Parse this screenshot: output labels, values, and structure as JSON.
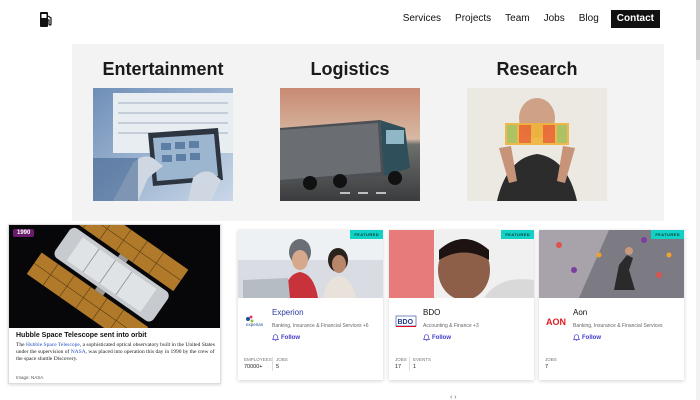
{
  "nav": {
    "logo_icon": "fuel-pump-icon",
    "links": [
      "Services",
      "Projects",
      "Team",
      "Jobs",
      "Blog"
    ],
    "cta": "Contact"
  },
  "categories": [
    {
      "title": "Entertainment",
      "image": "tablet-hands-photo"
    },
    {
      "title": "Logistics",
      "image": "truck-highway-photo"
    },
    {
      "title": "Research",
      "image": "person-color-filters-photo"
    }
  ],
  "hubble": {
    "badge": "1990",
    "title": "Hubble Space Telescope sent into orbit",
    "desc_prefix": "The ",
    "desc_link1": "Hubble Space Telescope",
    "desc_mid": ", a sophisticated optical observatory built in the United States under the supervision of ",
    "desc_link2": "NASA",
    "desc_suffix": ", was placed into operation this day in 1990 by the crew of the space shuttle Discovery.",
    "credit": "Image: NASA"
  },
  "companies": [
    {
      "badge": "FEATURED",
      "name": "Experion",
      "subtitle": "Banking, Insurance & Financial Services +6",
      "follow": "Follow",
      "stats": [
        {
          "label": "Employees",
          "value": "70000+"
        },
        {
          "label": "Jobs",
          "value": "5"
        }
      ],
      "logo_color": "#1d4f91"
    },
    {
      "badge": "FEATURED",
      "name": "BDO",
      "subtitle": "Accounting & Finance +3",
      "follow": "Follow",
      "stats": [
        {
          "label": "Jobs",
          "value": "17"
        },
        {
          "label": "Events",
          "value": "1"
        }
      ],
      "logo_color": "#e2001a"
    },
    {
      "badge": "FEATURED",
      "name": "Aon",
      "subtitle": "Banking, Insurance & Financial Services",
      "follow": "Follow",
      "stats": [
        {
          "label": "Jobs",
          "value": "7"
        }
      ],
      "logo_color": "#e11b22"
    }
  ],
  "pagination": "‹ ›"
}
